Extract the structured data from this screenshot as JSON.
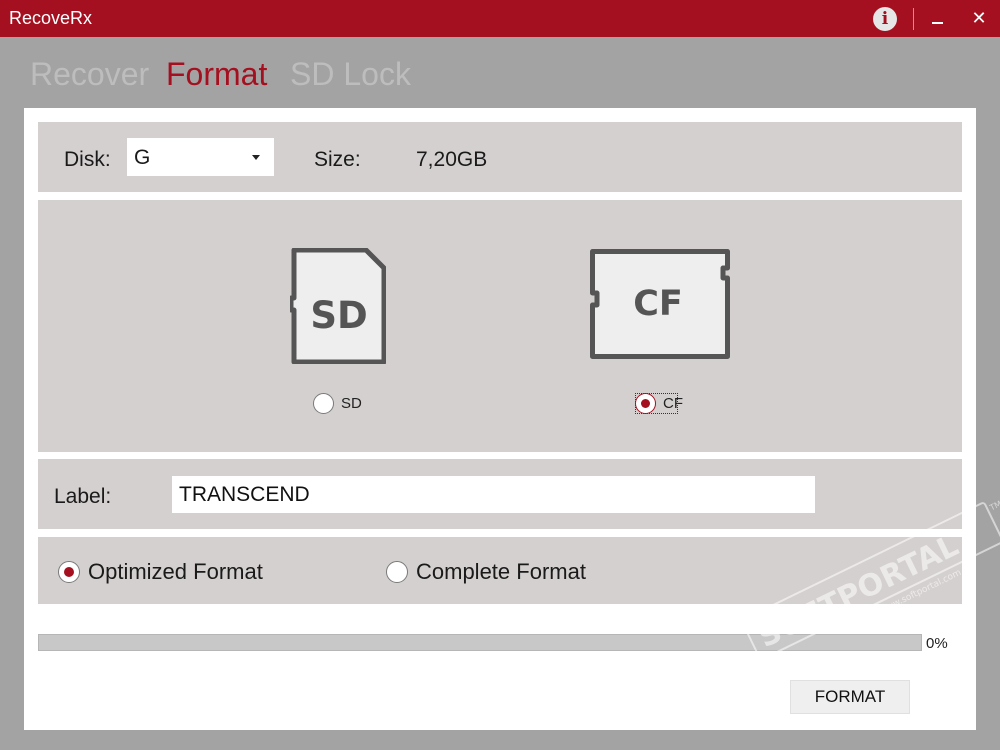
{
  "window": {
    "title": "RecoveRx"
  },
  "tabs": [
    {
      "label": "Recover",
      "active": false
    },
    {
      "label": "Format",
      "active": true
    },
    {
      "label": "SD Lock",
      "active": false
    }
  ],
  "disk": {
    "label": "Disk:",
    "value": "G",
    "size_label": "Size:",
    "size_value": "7,20GB"
  },
  "cards": [
    {
      "icon_text": "SD",
      "radio_label": "SD",
      "selected": false
    },
    {
      "icon_text": "CF",
      "radio_label": "CF",
      "selected": true
    }
  ],
  "volume": {
    "label": "Label:",
    "value": "TRANSCEND"
  },
  "format_mode": {
    "options": [
      {
        "label": "Optimized Format",
        "selected": true
      },
      {
        "label": "Complete Format",
        "selected": false
      }
    ]
  },
  "progress": {
    "percent_text": "0%",
    "value": 0
  },
  "actions": {
    "format_label": "FORMAT"
  },
  "watermark": {
    "text": "SOFTPORTAL",
    "sub": "www.softportal.com",
    "tm": "TM"
  },
  "colors": {
    "accent": "#a51020",
    "panel": "#d5d0d0",
    "window_bg": "#a3a3a3",
    "tab_inactive": "#bdbdbd"
  }
}
